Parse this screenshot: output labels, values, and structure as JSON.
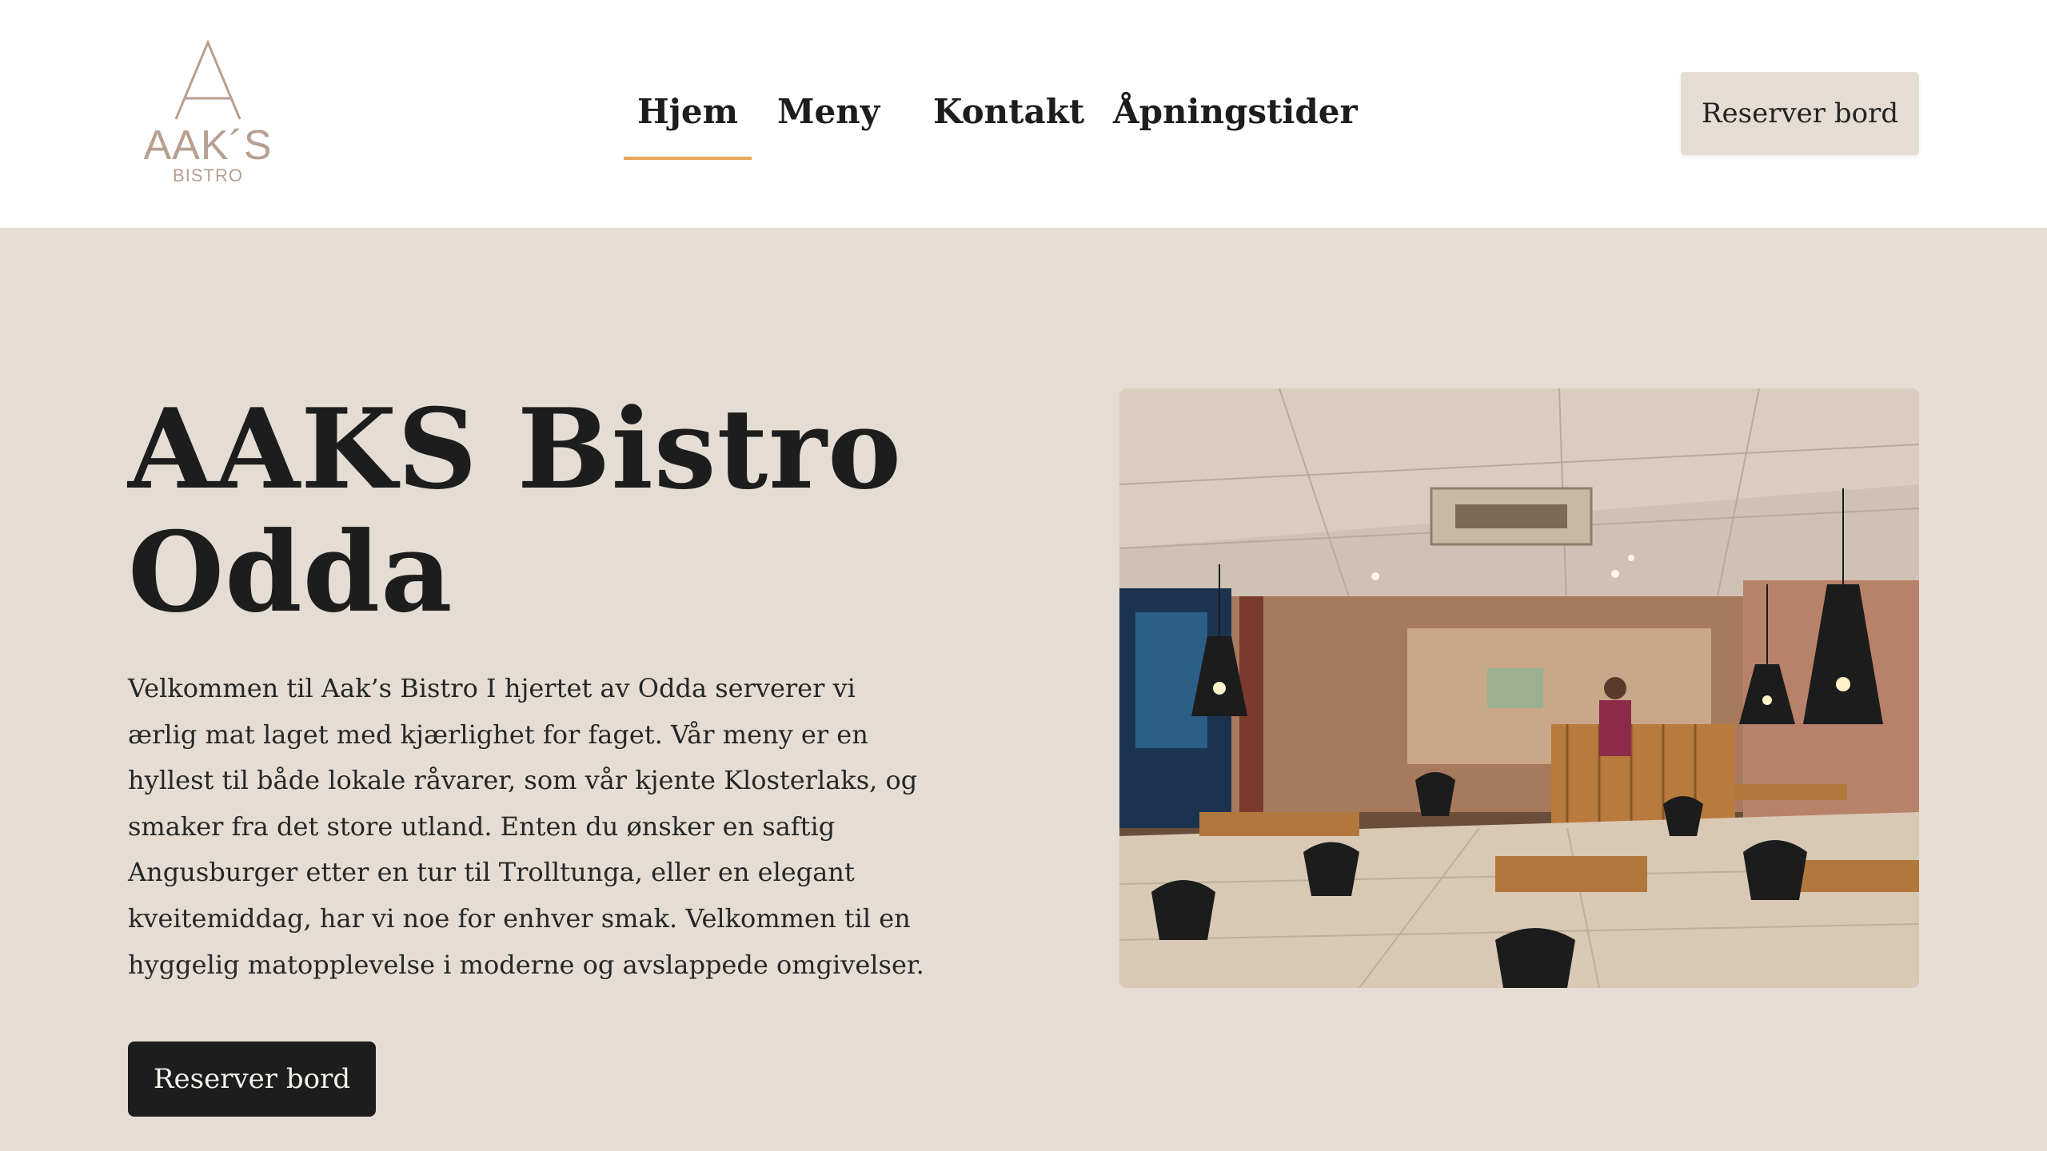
{
  "header": {
    "logo": {
      "name": "AAK´S",
      "subtitle": "BISTRO"
    },
    "nav": [
      {
        "label": "Hjem",
        "active": true
      },
      {
        "label": "Meny",
        "active": false
      },
      {
        "label": "Kontakt",
        "active": false
      },
      {
        "label": "Åpningstider",
        "active": false
      }
    ],
    "reserve_button": "Reserver bord"
  },
  "hero": {
    "title_line1": "AAKS Bistro",
    "title_line2": "Odda",
    "intro": "Velkommen til Aak’s Bistro I hjertet av Odda serverer vi ærlig mat laget med kjærlighet for faget. Vår meny er en hyllest til både lokale råvarer, som vår kjente Klosterlaks, og smaker fra det store utland. Enten du ønsker en saftig Angusburger etter en tur til Trolltunga, eller en elegant kveitemiddag, har vi noe for enhver smak. Velkommen til en hyggelig matopplevelse i moderne og avslappede omgivelser.",
    "cta_button": "Reserver bord",
    "image_icon": "restaurant-interior-photo"
  },
  "colors": {
    "background": "#e5ddd3",
    "header_bg": "#ffffff",
    "text": "#1d1d1d",
    "accent_underline": "#e6a85a",
    "logo": "#b79f91",
    "cta_bg": "#1d1d1d"
  }
}
